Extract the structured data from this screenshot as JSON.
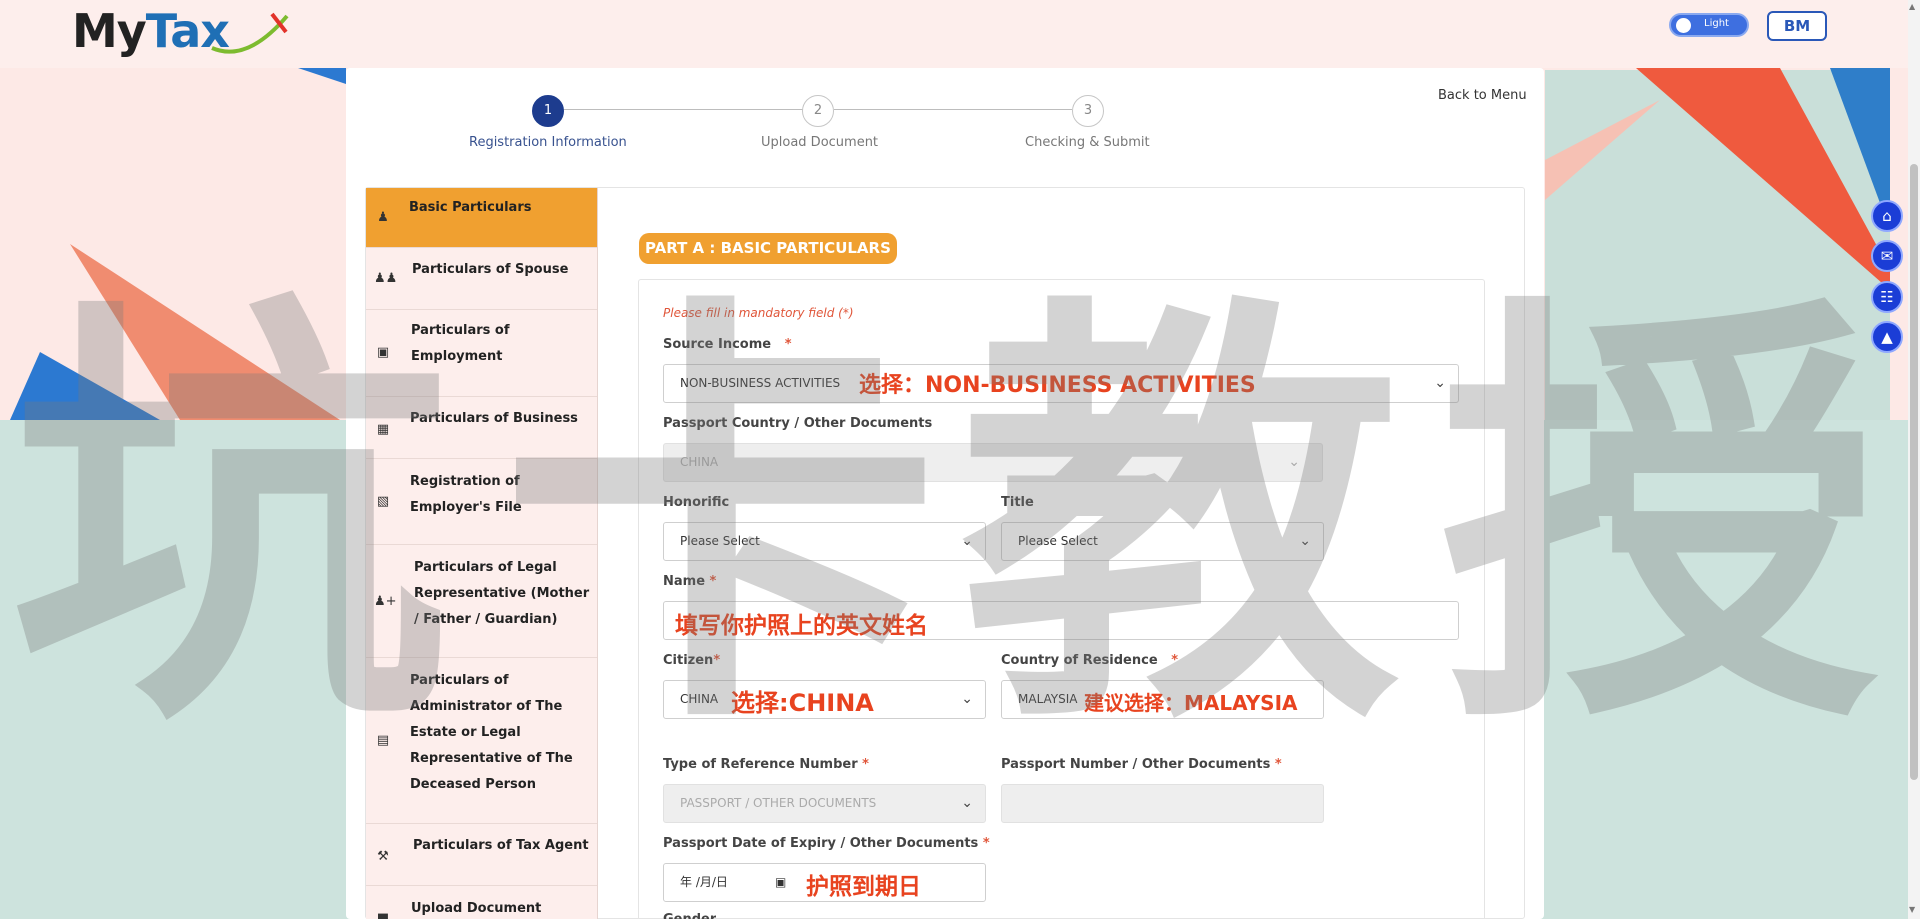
{
  "header": {
    "logo_text_my": "My",
    "logo_text_tax": "Tax",
    "theme_toggle_label": "Light",
    "user_badge": "BM"
  },
  "nav": {
    "back_to_menu": "Back to Menu"
  },
  "stepper": [
    {
      "number": "1",
      "label": "Registration Information",
      "active": true
    },
    {
      "number": "2",
      "label": "Upload Document",
      "active": false
    },
    {
      "number": "3",
      "label": "Checking & Submit",
      "active": false
    }
  ],
  "sidebar": {
    "items": [
      {
        "icon": "user-icon",
        "label": "Basic Particulars",
        "active": true
      },
      {
        "icon": "users-icon",
        "label": "Particulars of Spouse"
      },
      {
        "icon": "briefcase-icon",
        "label": "Particulars of Employment"
      },
      {
        "icon": "building-icon",
        "label": "Particulars of Business"
      },
      {
        "icon": "id-badge-icon",
        "label": "Registration of Employer's File"
      },
      {
        "icon": "user-plus-icon",
        "label": "Particulars of Legal Representative (Mother / Father / Guardian)"
      },
      {
        "icon": "file-icon",
        "label": "Particulars of Administrator of The Estate or Legal Representative of The Deceased Person"
      },
      {
        "icon": "gavel-icon",
        "label": "Particulars of Tax Agent"
      },
      {
        "icon": "folder-icon",
        "label": "Upload Document"
      }
    ]
  },
  "form": {
    "section_title": "PART A : BASIC PARTICULARS",
    "mandatory_note": "Please fill in mandatory field (*)",
    "required_mark": "*",
    "source_income": {
      "label": "Source Income",
      "value": "NON-BUSINESS ACTIVITIES"
    },
    "passport_country": {
      "label": "Passport Country / Other Documents",
      "value": "CHINA"
    },
    "honorific": {
      "label": "Honorific",
      "value": "Please Select"
    },
    "title": {
      "label": "Title",
      "value": "Please Select"
    },
    "name": {
      "label": "Name",
      "value": ""
    },
    "citizen": {
      "label": "Citizen",
      "value": "CHINA"
    },
    "country_of_residence": {
      "label": "Country of Residence",
      "value": "MALAYSIA"
    },
    "reference_type": {
      "label": "Type of Reference Number",
      "value": "PASSPORT / OTHER DOCUMENTS"
    },
    "passport_number": {
      "label": "Passport Number / Other Documents",
      "value": ""
    },
    "passport_expiry": {
      "label": "Passport Date of Expiry / Other Documents",
      "placeholder": "年 /月/日"
    },
    "next_label_partial": "Gender"
  },
  "annotations": {
    "source_income": "选择：NON-BUSINESS ACTIVITIES",
    "name": "填写你护照上的英文姓名",
    "citizen": "选择:CHINA",
    "residence": "建议选择：MALAYSIA",
    "expiry": "护照到期日"
  },
  "watermark": {
    "chars": [
      "坑",
      "卡",
      "教",
      "授"
    ]
  },
  "floating_buttons": [
    "home-icon",
    "megaphone-icon",
    "book-icon",
    "graduation-cap-icon"
  ],
  "colors": {
    "accent_orange": "#f0a030",
    "step_active": "#1d3c8e",
    "annotation_red": "#e8431f",
    "fab_blue": "#1b3dd6"
  }
}
